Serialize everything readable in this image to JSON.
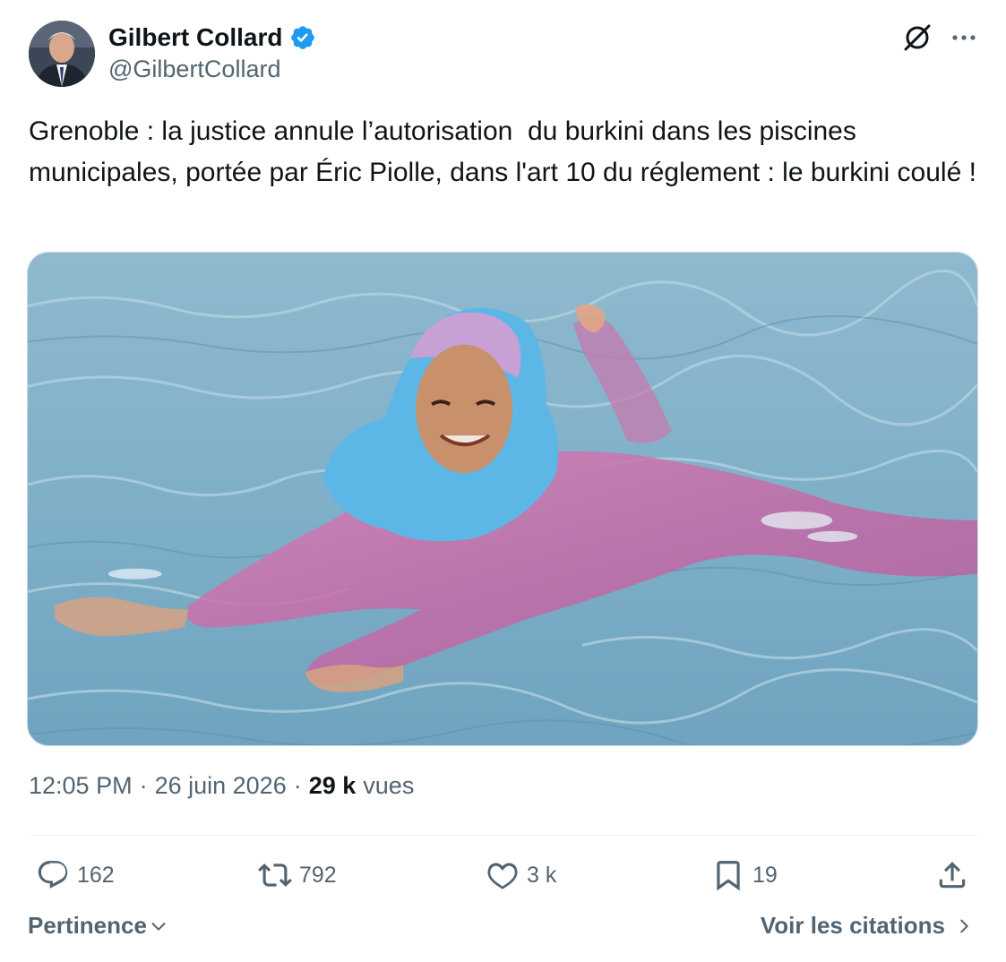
{
  "author": {
    "display_name": "Gilbert Collard",
    "handle": "@GilbertCollard",
    "verified": true
  },
  "tweet": {
    "text": "Grenoble : la justice annule l’autorisation  du burkini dans les piscines municipales, portée par Éric Piolle, dans l'art 10 du réglement : le burkini coulé !",
    "image_alt": "Femme en burkini rose et hijab bleu nageant dans une piscine"
  },
  "meta": {
    "time": "12:05 PM",
    "separator": "·",
    "date": "26 juin 2026",
    "views_count": "29 k",
    "views_label": "vues"
  },
  "actions": {
    "replies": "162",
    "reposts": "792",
    "likes": "3 k",
    "bookmarks": "19"
  },
  "footer": {
    "sort_label": "Pertinence",
    "quotes_label": "Voir les citations"
  },
  "icons": {
    "header_right": [
      "grok-icon",
      "more-icon"
    ],
    "actions": [
      "reply-icon",
      "repost-icon",
      "like-icon",
      "bookmark-icon",
      "share-icon"
    ]
  },
  "colors": {
    "text_primary": "#0f1419",
    "text_secondary": "#536471",
    "verified_blue": "#1d9bf0",
    "divider": "#eff3f4"
  }
}
